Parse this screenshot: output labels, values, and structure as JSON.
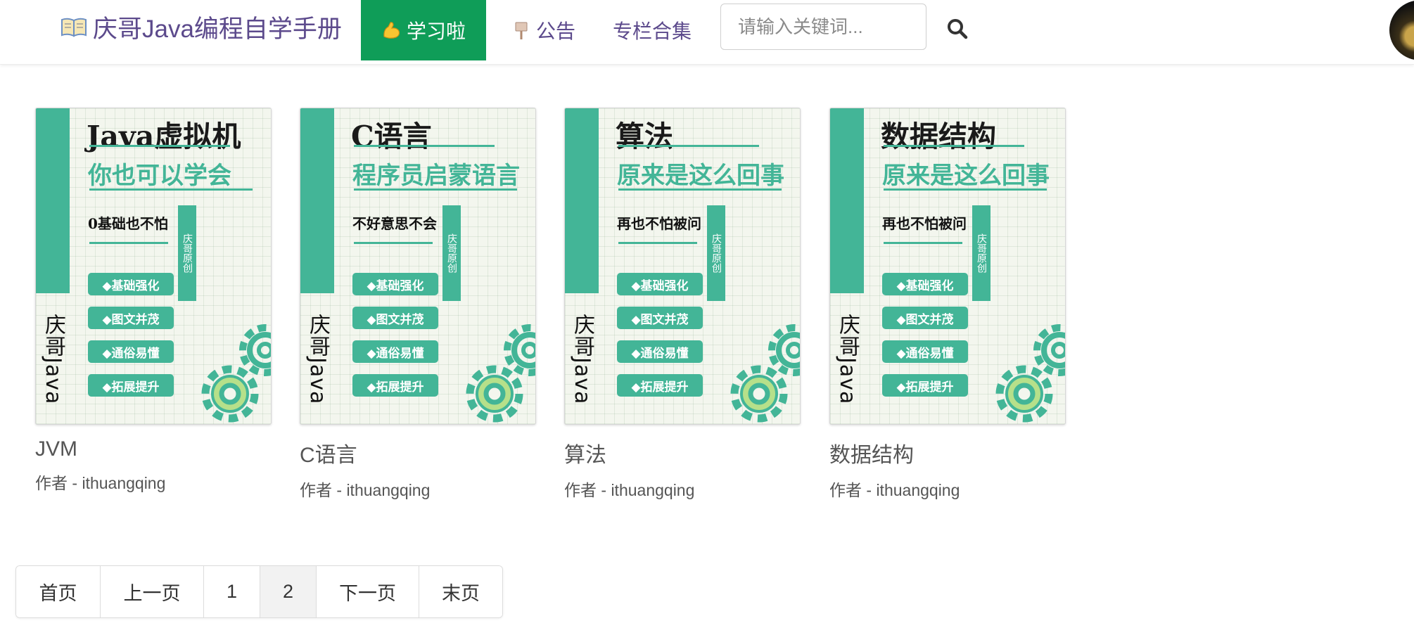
{
  "nav": {
    "brand": "庆哥Java编程自学手册",
    "items": [
      {
        "label": "学习啦",
        "active": true,
        "icon": "flexed-biceps-icon"
      },
      {
        "label": "公告",
        "active": false,
        "icon": "placard-icon"
      },
      {
        "label": "专栏合集",
        "active": false
      }
    ],
    "search_placeholder": "请输入关键词...",
    "search_icon": "search-icon"
  },
  "books": [
    {
      "title": "JVM",
      "author": "作者 - ithuangqing",
      "cover": {
        "headline": "Java虚拟机",
        "subline": "你也可以学会",
        "tagline": "0基础也不怕",
        "vertical_tag": "庆哥原创",
        "side": "庆哥Java",
        "features": [
          "◆基础强化",
          "◆图文并茂",
          "◆通俗易懂",
          "◆拓展提升"
        ]
      }
    },
    {
      "title": "C语言",
      "author": "作者 - ithuangqing",
      "cover": {
        "headline": "C语言",
        "subline": "程序员启蒙语言",
        "tagline": "不好意思不会",
        "vertical_tag": "庆哥原创",
        "side": "庆哥Java",
        "features": [
          "◆基础强化",
          "◆图文并茂",
          "◆通俗易懂",
          "◆拓展提升"
        ]
      }
    },
    {
      "title": "算法",
      "author": "作者 - ithuangqing",
      "cover": {
        "headline": "算法",
        "subline": "原来是这么回事",
        "tagline": "再也不怕被问",
        "vertical_tag": "庆哥原创",
        "side": "庆哥Java",
        "features": [
          "◆基础强化",
          "◆图文并茂",
          "◆通俗易懂",
          "◆拓展提升"
        ]
      }
    },
    {
      "title": "数据结构",
      "author": "作者 - ithuangqing",
      "cover": {
        "headline": "数据结构",
        "subline": "原来是这么回事",
        "tagline": "再也不怕被问",
        "vertical_tag": "庆哥原创",
        "side": "庆哥Java",
        "features": [
          "◆基础强化",
          "◆图文并茂",
          "◆通俗易懂",
          "◆拓展提升"
        ]
      }
    }
  ],
  "pagination": {
    "first": "首页",
    "prev": "上一页",
    "pages": [
      "1",
      "2"
    ],
    "current": "2",
    "next": "下一页",
    "last": "末页"
  },
  "colors": {
    "brand_text": "#5c4a8c",
    "active_nav_bg": "#0f9d58",
    "cover_accent": "#43b597",
    "gear_light": "#b6e08a"
  }
}
